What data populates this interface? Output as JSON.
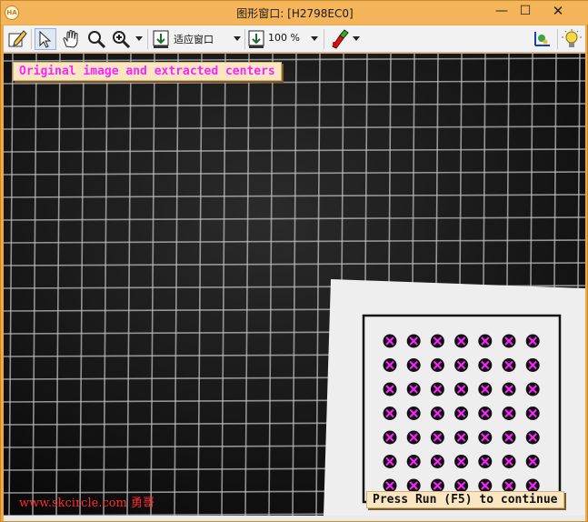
{
  "window": {
    "title": "图形窗口: [H2798EC0]",
    "app_icon_text": "HA",
    "minimize": "—",
    "maximize": "☐",
    "close": "✕"
  },
  "toolbar": {
    "icons": [
      "edit-pen-icon",
      "select-arrow-icon",
      "pan-hand-icon",
      "magnifier-icon",
      "zoom-in-icon",
      "fit-window-icon",
      "zoom-percent-icon",
      "paint-color-icon",
      "3d-view-icon",
      "lightbulb-icon"
    ],
    "fit_label": "适应窗口",
    "zoom_value": "100 %"
  },
  "canvas": {
    "message": "Original image and extracted centers",
    "continue_prompt": "Press Run (F5) to continue",
    "watermark": "www.skcircle.com 勇哥",
    "calibration_plate": {
      "rows": 7,
      "cols": 7
    },
    "colors": {
      "marker": "#ff22ff",
      "dots": "#111111",
      "grid": "#bdbdbd",
      "plate": "#f1f1f1"
    }
  }
}
